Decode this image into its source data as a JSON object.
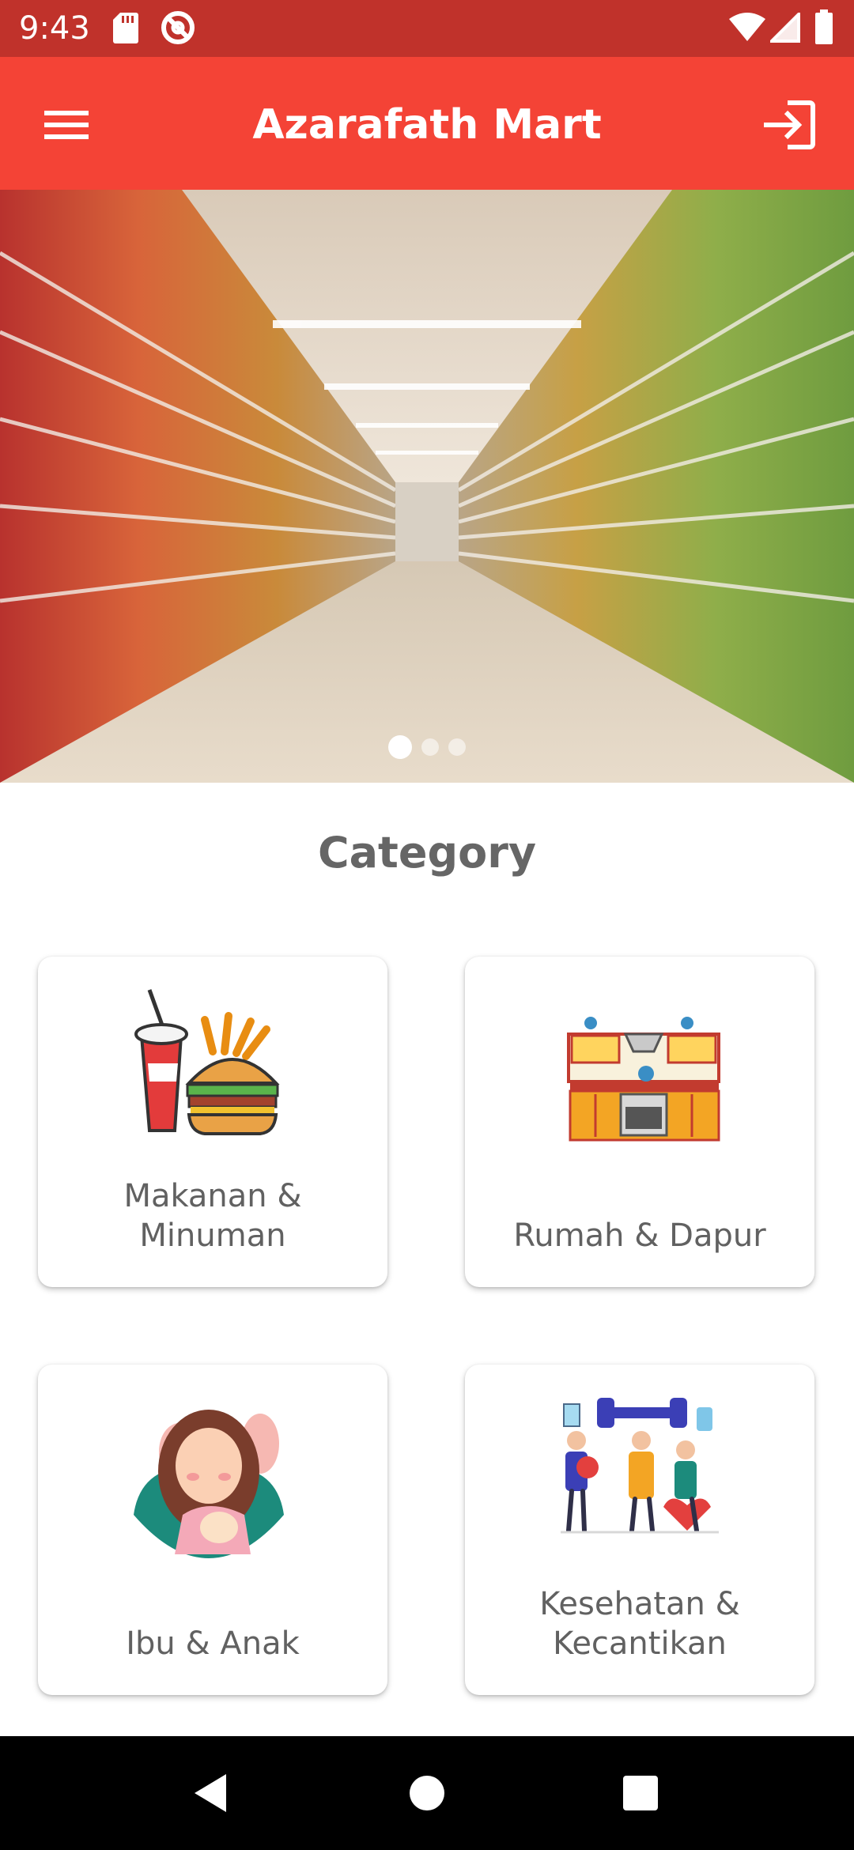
{
  "status_bar": {
    "time": "9:43",
    "icons": [
      "sd-card-icon",
      "do-not-disturb-icon",
      "wifi-icon",
      "signal-icon",
      "battery-icon"
    ]
  },
  "app_bar": {
    "title": "Azarafath Mart",
    "menu_icon": "hamburger-menu-icon",
    "action_icon": "login-icon",
    "color": "#f44336"
  },
  "banner": {
    "image": "supermarket-aisle-photo",
    "page_count": 3,
    "active_index": 0
  },
  "category": {
    "title": "Category",
    "items": [
      {
        "label": "Makanan &\nMinuman",
        "icon": "food-drink-icon"
      },
      {
        "label": "Rumah & Dapur",
        "icon": "kitchen-icon"
      },
      {
        "label": "Ibu & Anak",
        "icon": "mother-child-icon"
      },
      {
        "label": "Kesehatan &\nKecantikan",
        "icon": "health-beauty-icon"
      }
    ]
  },
  "nav_bar": {
    "buttons": [
      "back-icon",
      "home-icon",
      "recents-icon"
    ]
  }
}
